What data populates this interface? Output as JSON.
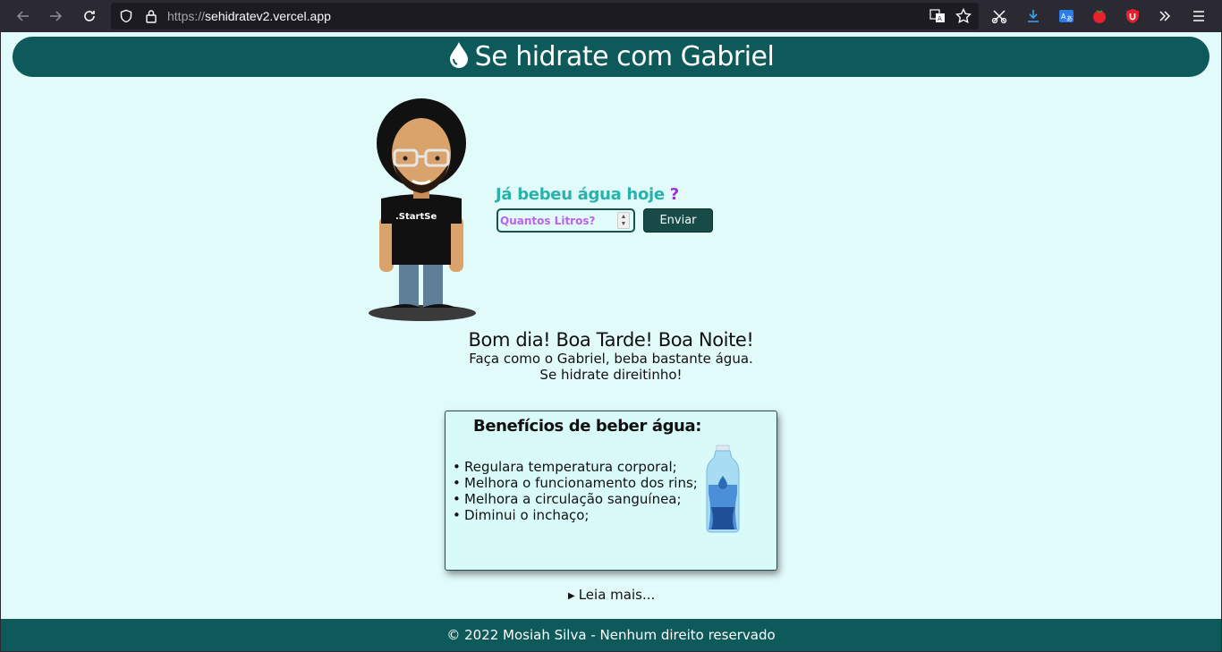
{
  "browser": {
    "url_protocol": "https://",
    "url_host": "sehidratev2.vercel.app",
    "icons": [
      "back-icon",
      "forward-icon",
      "reload-icon",
      "shield-icon",
      "lock-icon",
      "translate-icon",
      "bookmark-star-icon",
      "screenshot-icon",
      "download-icon",
      "translate-extension-icon",
      "tomato-extension-icon",
      "ublock-extension-icon",
      "overflow-chevrons-icon",
      "hamburger-menu-icon"
    ]
  },
  "header": {
    "title": "Se hidrate com Gabriel",
    "icon": "water-drop-icon"
  },
  "form": {
    "question": "Já bebeu água hoje",
    "question_mark": "?",
    "input_placeholder": "Quantos Litros?",
    "submit_label": "Enviar"
  },
  "greeting": {
    "title": "Bom dia! Boa Tarde! Boa Noite!",
    "line1": "Faça como o Gabriel, beba bastante água.",
    "line2": "Se hidrate direitinho!"
  },
  "benefits": {
    "title": "Benefícios de beber água:",
    "items": [
      "Regulara temperatura corporal;",
      "Melhora o funcionamento dos rins;",
      "Melhora a circulação sanguínea;",
      "Diminui o inchaço;"
    ]
  },
  "read_more": "Leia mais...",
  "avatar_shirt_text": ".StartSe",
  "footer": {
    "text": "© 2022 Mosiah Silva - Nenhum direito reservado"
  },
  "colors": {
    "primary": "#0e5a5a",
    "background": "#e1fbfa",
    "question": "#29b2ac",
    "question_mark": "#9b2ee0",
    "placeholder": "#b964f0",
    "button": "#174b47"
  }
}
